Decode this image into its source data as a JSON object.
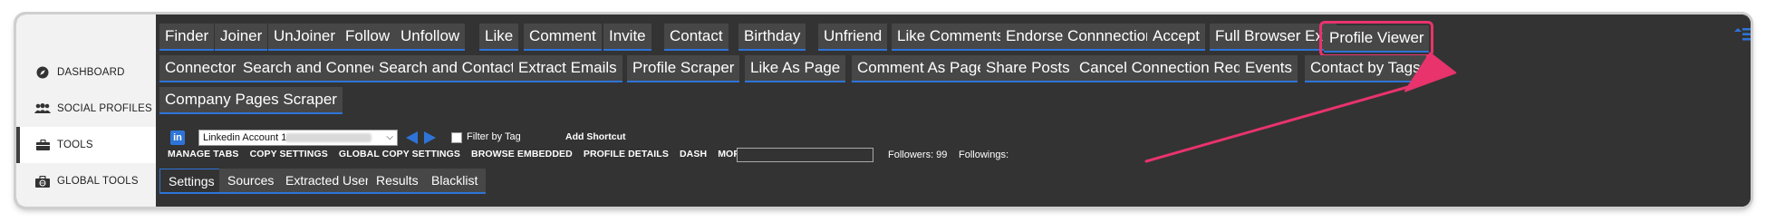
{
  "sidebar": {
    "items": [
      {
        "label": "DASHBOARD",
        "icon": "compass-icon"
      },
      {
        "label": "SOCIAL PROFILES",
        "icon": "users-icon"
      },
      {
        "label": "TOOLS",
        "icon": "briefcase-icon"
      },
      {
        "label": "GLOBAL TOOLS",
        "icon": "globe-toolbox-icon"
      }
    ],
    "active_index": 2
  },
  "tools_row1": [
    "Finder",
    "Joiner",
    "UnJoiner",
    "Follow",
    "Unfollow",
    "Like",
    "Comment",
    "Invite",
    "Contact",
    "Birthday",
    "Unfriend",
    "Like Comments",
    "Endorse Connnections",
    "Accept",
    "Full Browser Exp",
    "Profile Viewer"
  ],
  "tools_row2": [
    "Connector",
    "Search and Connect",
    "Search and Contact",
    "Extract Emails",
    "Profile Scraper",
    "Like As Page",
    "Comment As Page",
    "Share Posts",
    "Cancel Connection Requests",
    "Events",
    "Contact by Tags"
  ],
  "tools_row3": [
    "Company Pages Scraper"
  ],
  "account": {
    "network_icon": "linkedin-icon",
    "selected": "Linkedin Account 1",
    "filter_label": "Filter by Tag",
    "add_shortcut": "Add Shortcut"
  },
  "links": [
    "MANAGE TABS",
    "COPY SETTINGS",
    "GLOBAL COPY SETTINGS",
    "BROWSE EMBEDDED",
    "PROFILE DETAILS",
    "DASH",
    "MORE..."
  ],
  "stats": {
    "followers": "Followers: 99",
    "followings": "Followings:"
  },
  "subtabs": [
    "Settings",
    "Sources",
    "Extracted Users",
    "Results",
    "Blacklist"
  ],
  "highlight": {
    "target": "Profile Viewer",
    "color": "#e8336d"
  },
  "colors": {
    "accent": "#2e74d8",
    "panel": "#333333",
    "button": "#474747",
    "highlight": "#e8336d"
  }
}
